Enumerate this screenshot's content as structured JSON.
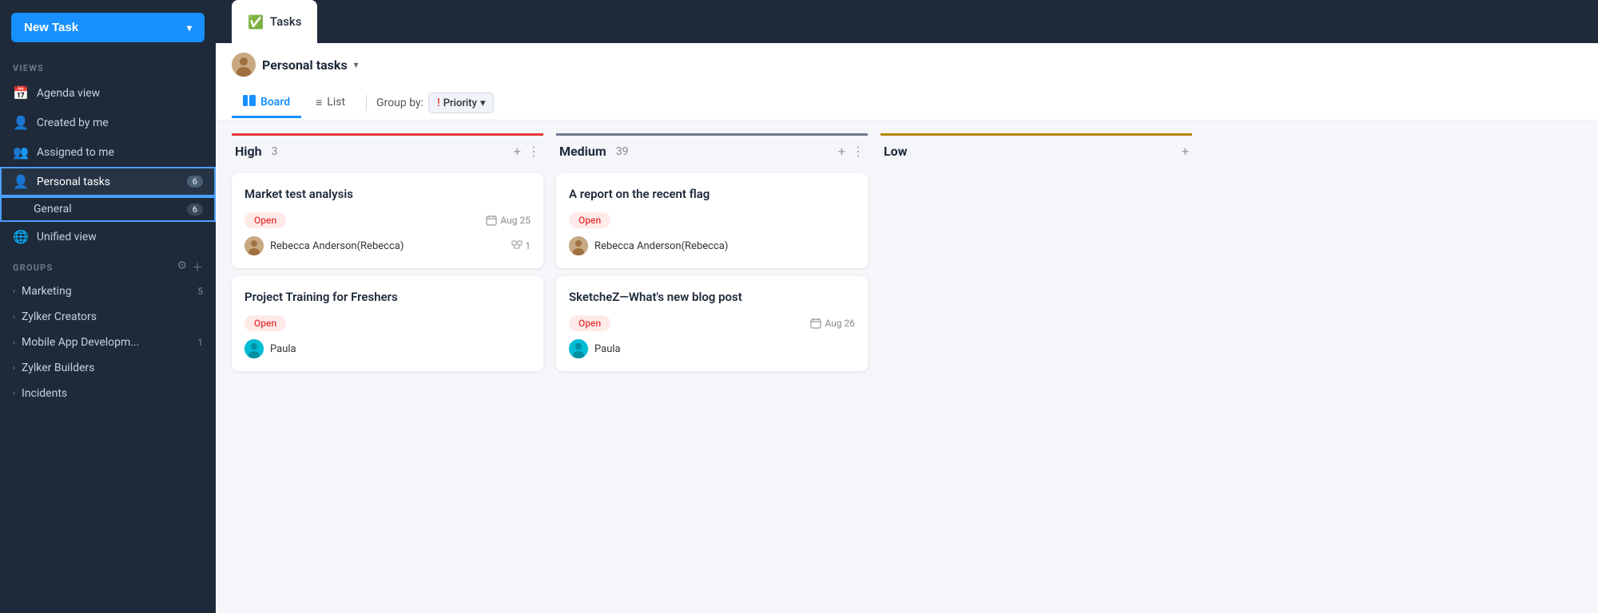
{
  "sidebar": {
    "new_task_label": "New Task",
    "views_label": "VIEWS",
    "groups_label": "GROUPS",
    "nav_items": [
      {
        "id": "agenda",
        "label": "Agenda view",
        "icon": "📅"
      },
      {
        "id": "created",
        "label": "Created by me",
        "icon": "👤"
      },
      {
        "id": "assigned",
        "label": "Assigned to me",
        "icon": "👥"
      },
      {
        "id": "personal",
        "label": "Personal tasks",
        "icon": "👤",
        "badge": "6",
        "active": true
      },
      {
        "id": "general",
        "label": "General",
        "icon": "",
        "sub": true,
        "badge": "6"
      },
      {
        "id": "unified",
        "label": "Unified view",
        "icon": "🌐"
      }
    ],
    "groups": [
      {
        "id": "marketing",
        "label": "Marketing",
        "badge": "5"
      },
      {
        "id": "zylker-creators",
        "label": "Zylker Creators",
        "badge": ""
      },
      {
        "id": "mobile-app",
        "label": "Mobile App Developm...",
        "badge": "1"
      },
      {
        "id": "zylker-builders",
        "label": "Zylker Builders",
        "badge": ""
      },
      {
        "id": "incidents",
        "label": "Incidents",
        "badge": ""
      }
    ]
  },
  "topbar": {
    "tab_label": "Tasks",
    "tab_icon": "✅"
  },
  "header": {
    "workspace_name": "Personal tasks",
    "board_tab": "Board",
    "list_tab": "List",
    "group_by_label": "Group by:",
    "priority_label": "Priority"
  },
  "columns": [
    {
      "id": "high",
      "title": "High",
      "count": "3",
      "color_class": "high",
      "cards": [
        {
          "id": "c1",
          "title": "Market test analysis",
          "status": "Open",
          "date": "Aug 25",
          "assignee": "Rebecca Anderson(Rebecca)",
          "subtasks": "1",
          "avatar_color": "brown"
        },
        {
          "id": "c2",
          "title": "Project Training for Freshers",
          "status": "Open",
          "date": "",
          "assignee": "Paula",
          "subtasks": "",
          "avatar_color": "teal"
        }
      ]
    },
    {
      "id": "medium",
      "title": "Medium",
      "count": "39",
      "color_class": "medium",
      "cards": [
        {
          "id": "c3",
          "title": "A report on the recent flag",
          "status": "Open",
          "date": "",
          "assignee": "Rebecca Anderson(Rebecca)",
          "subtasks": "",
          "avatar_color": "brown"
        },
        {
          "id": "c4",
          "title": "SketcheZ—What's new blog post",
          "status": "Open",
          "date": "Aug 26",
          "assignee": "Paula",
          "subtasks": "",
          "avatar_color": "teal"
        }
      ]
    },
    {
      "id": "low",
      "title": "Low",
      "count": "",
      "color_class": "low",
      "cards": []
    }
  ]
}
